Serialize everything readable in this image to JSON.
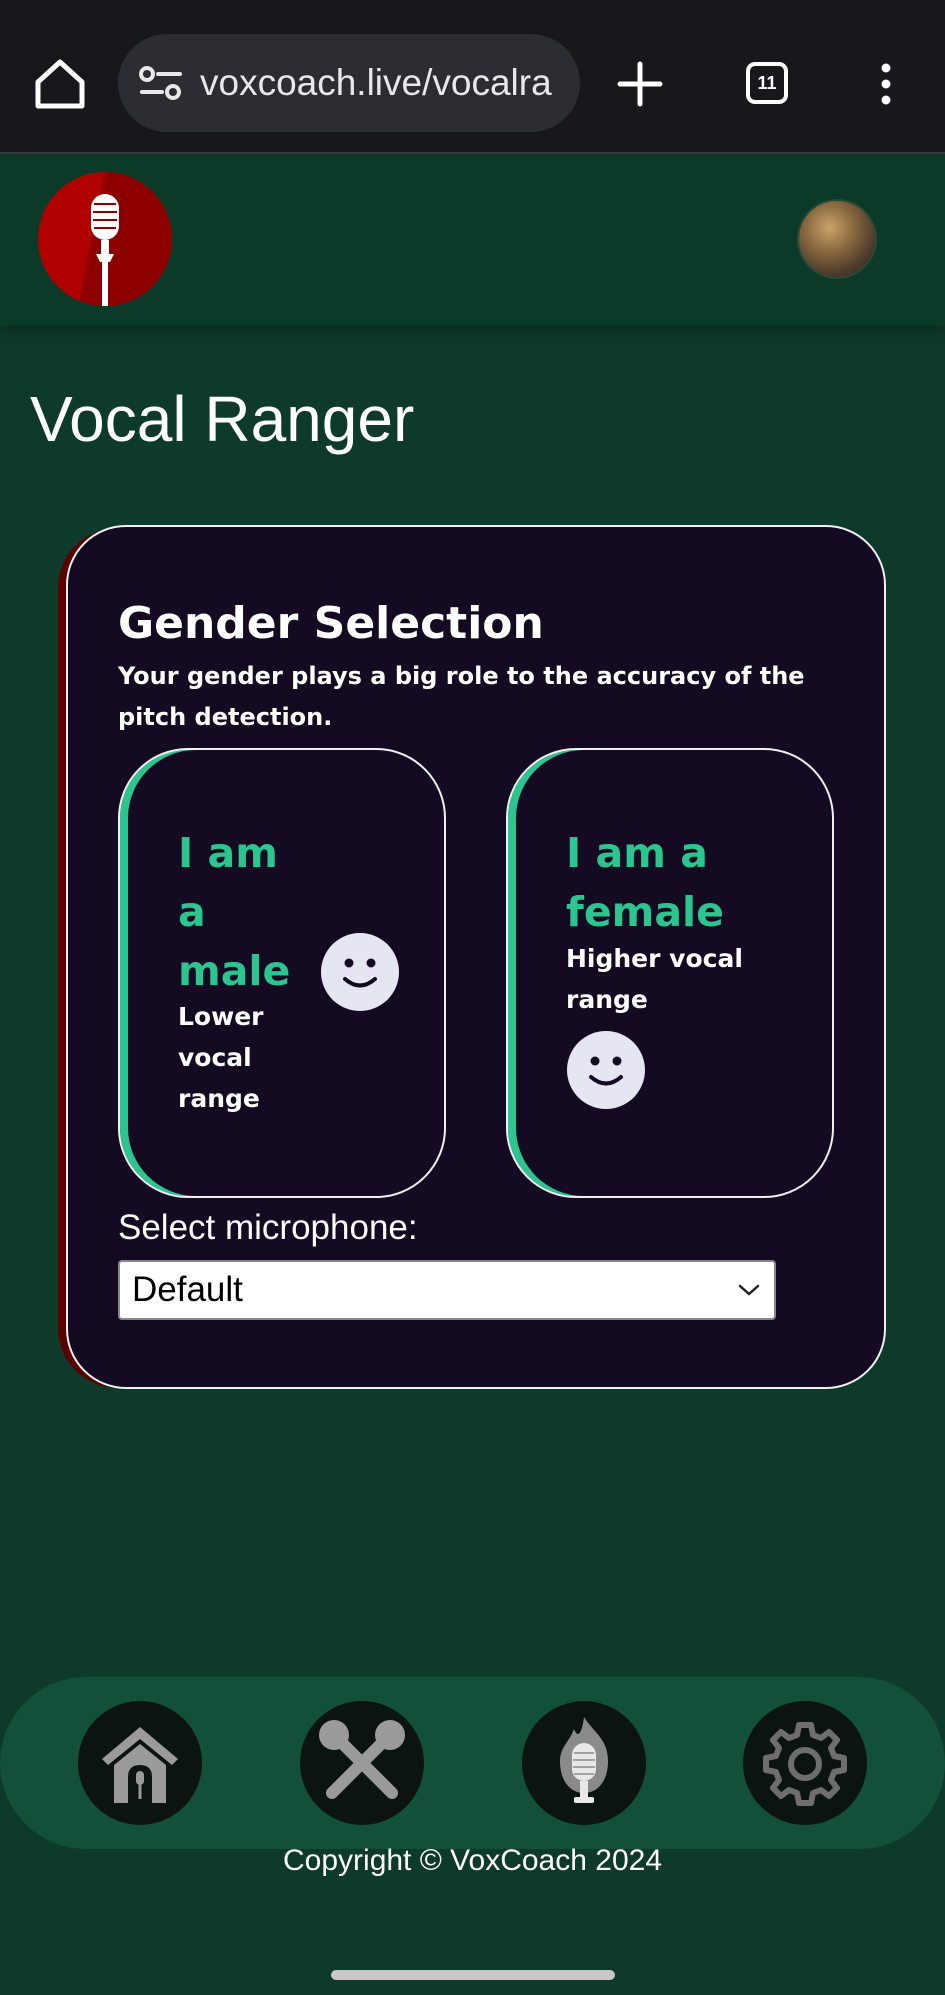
{
  "browser": {
    "url": "voxcoach.live/vocalra",
    "tab_count": "11"
  },
  "page": {
    "title": "Vocal Ranger"
  },
  "gender_card": {
    "title": "Gender Selection",
    "subtitle": "Your gender plays a big role to the accuracy of the pitch detection.",
    "male": {
      "title_lines": [
        "I am",
        "a",
        "male"
      ],
      "desc_lines": [
        "Lower",
        "vocal",
        "range"
      ]
    },
    "female": {
      "title_lines": [
        "I am a",
        "female"
      ],
      "desc_lines": [
        "Higher vocal",
        "range"
      ]
    },
    "mic_label": "Select microphone:",
    "mic_selected": "Default"
  },
  "nav": {
    "items": [
      "home-icon",
      "crossed-microphones-icon",
      "flaming-microphone-icon",
      "gear-icon"
    ]
  },
  "footer": {
    "copyright": "Copyright © VoxCoach 2024"
  },
  "colors": {
    "accent": "#2cc590",
    "page_bg": "#0d3a2a",
    "card_bg": "#140a22",
    "logo_red": "#b10000"
  }
}
